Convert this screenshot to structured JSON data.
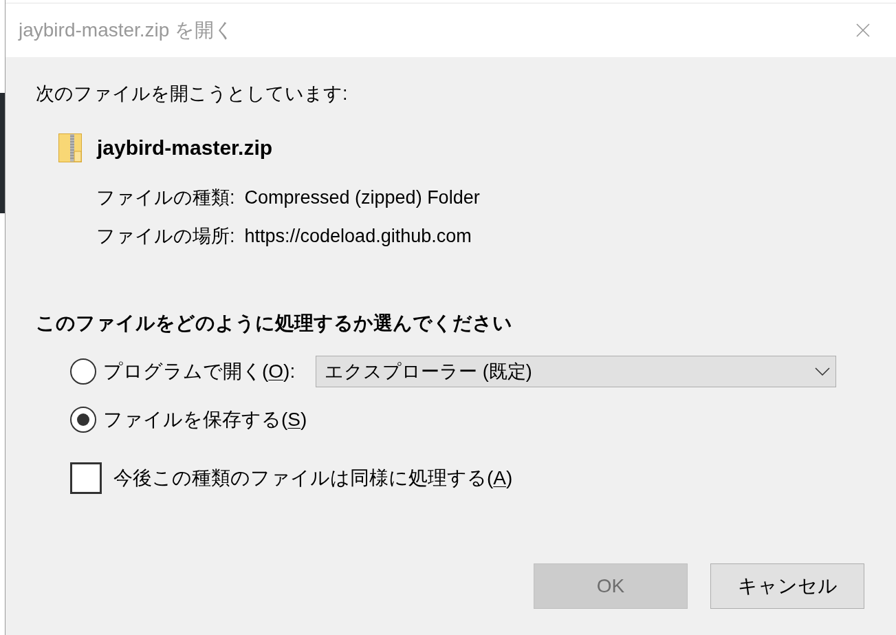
{
  "window": {
    "title": "jaybird-master.zip を開く"
  },
  "intro": "次のファイルを開こうとしています:",
  "file": {
    "name": "jaybird-master.zip",
    "details": [
      {
        "label": "ファイルの種類:",
        "value": "Compressed (zipped) Folder"
      },
      {
        "label": "ファイルの場所:",
        "value": "https://codeload.github.com"
      }
    ]
  },
  "question": "このファイルをどのように処理するか選んでください",
  "options": [
    {
      "kind": "radio",
      "label_start": "プログラムで開く(",
      "access_key": "O",
      "label_end": "):",
      "selected": false,
      "dropdown": {
        "value": "エクスプローラー (既定)"
      }
    },
    {
      "kind": "radio",
      "label_start": "ファイルを保存する(",
      "access_key": "S",
      "label_end": ")",
      "selected": true
    },
    {
      "kind": "checkbox",
      "label_start": "今後この種類のファイルは同様に処理する(",
      "access_key": "A",
      "label_end": ")",
      "checked": false
    }
  ],
  "buttons": [
    {
      "label": "OK",
      "disabled": true
    },
    {
      "label": "キャンセル",
      "disabled": false
    }
  ]
}
